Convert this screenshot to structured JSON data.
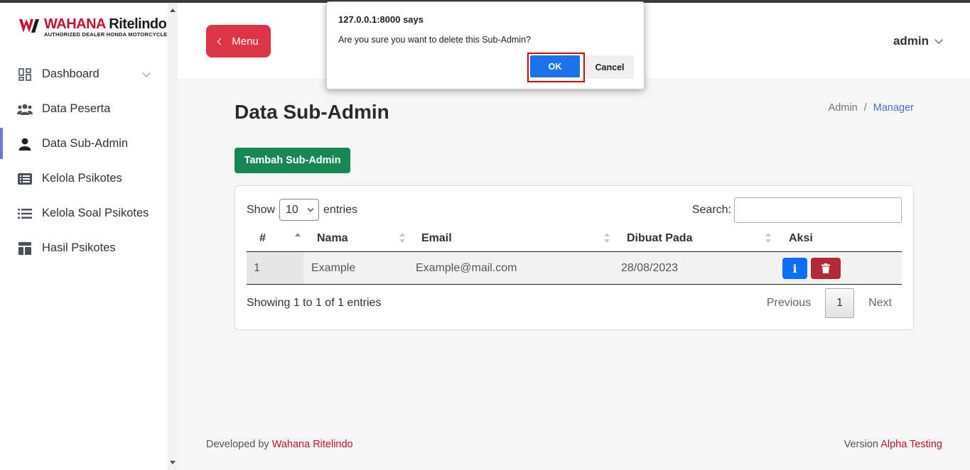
{
  "brand": {
    "name_part1": "WAHANA",
    "name_part2": " Ritelindo",
    "tagline": "AUTHORIZED DEALER HONDA MOTORCYCLE",
    "accent_color": "#c8102e"
  },
  "sidebar": {
    "items": [
      {
        "label": "Dashboard",
        "icon": "dashboard-grid-icon",
        "has_chevron": true
      },
      {
        "label": "Data Peserta",
        "icon": "users-group-icon"
      },
      {
        "label": "Data Sub-Admin",
        "icon": "user-icon",
        "active": true
      },
      {
        "label": "Kelola Psikotes",
        "icon": "list-card-icon"
      },
      {
        "label": "Kelola Soal Psikotes",
        "icon": "list-bullets-icon"
      },
      {
        "label": "Hasil Psikotes",
        "icon": "layout-icon"
      }
    ]
  },
  "header": {
    "menu_label": "Menu",
    "user_label": "admin"
  },
  "page": {
    "title": "Data Sub-Admin",
    "breadcrumb": {
      "parent": "Admin",
      "separator": "/",
      "current": "Manager"
    },
    "add_button": "Tambah Sub-Admin"
  },
  "table": {
    "show_label": "Show",
    "entries_value": "10",
    "entries_label": "entries",
    "search_label": "Search:",
    "search_value": "",
    "columns": [
      "#",
      "Nama",
      "Email",
      "Dibuat Pada",
      "Aksi"
    ],
    "rows": [
      {
        "no": "1",
        "nama": "Example",
        "email": "Example@mail.com",
        "dibuat": "28/08/2023"
      }
    ],
    "info": "Showing 1 to 1 of 1 entries",
    "pager": {
      "previous": "Previous",
      "current_page": "1",
      "next": "Next"
    }
  },
  "footer": {
    "left_prefix": "Developed by ",
    "left_link": "Wahana Ritelindo",
    "right_prefix": "Version ",
    "right_link": "Alpha Testing"
  },
  "dialog": {
    "title": "127.0.0.1:8000 says",
    "message": "Are you sure you want to delete this Sub-Admin?",
    "ok_label": "OK",
    "cancel_label": "Cancel"
  },
  "colors": {
    "danger": "#dc3545",
    "success": "#198754",
    "primary": "#0d6efd",
    "dialog_ok": "#1a73e8",
    "highlight": "#d40000"
  }
}
